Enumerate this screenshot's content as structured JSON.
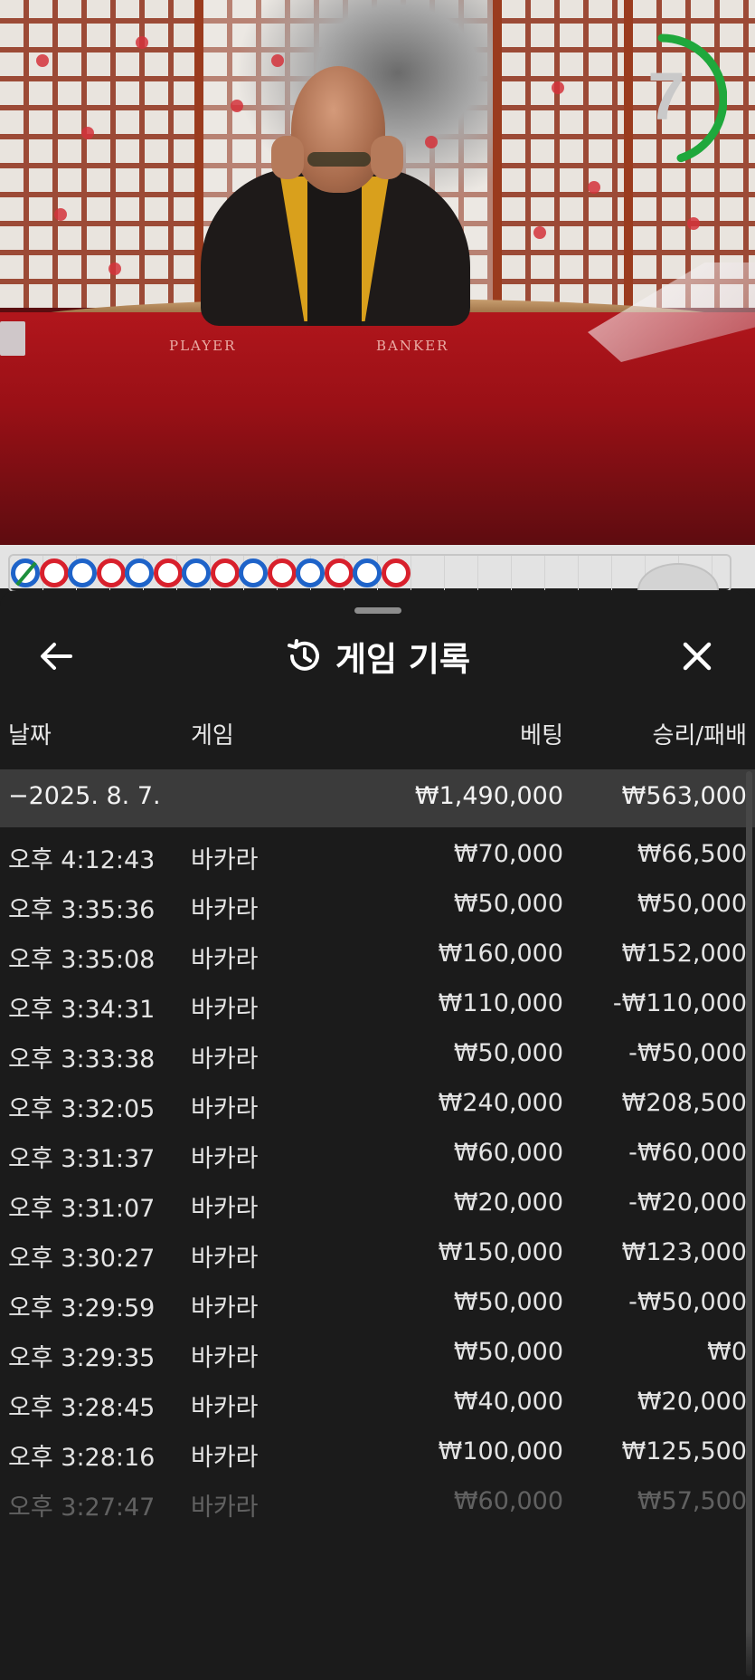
{
  "video": {
    "felt_labels": {
      "player": "PLAYER",
      "banker": "BANKER"
    },
    "timer": {
      "value": "7",
      "progress": 0.45,
      "color": "#1fa83c"
    }
  },
  "bead_road": {
    "beads": [
      "tie",
      "red",
      "blue",
      "red",
      "blue",
      "red",
      "blue",
      "red",
      "blue",
      "red",
      "blue",
      "red",
      "blue",
      "red"
    ],
    "colors": {
      "player": "#1e63c9",
      "banker": "#d8202c",
      "tie": "#1d8f3c"
    }
  },
  "history": {
    "title": "게임 기록",
    "icons": {
      "back": "arrow-left-icon",
      "history": "history-icon",
      "close": "close-icon"
    },
    "columns": {
      "date": "날짜",
      "game": "게임",
      "bet": "베팅",
      "result": "승리/패배"
    },
    "summary": {
      "date": "−2025. 8. 7.",
      "bet": "₩1,490,000",
      "result": "₩563,000"
    },
    "rows": [
      {
        "time": "오후 4:12:43",
        "game": "바카라",
        "bet": "₩70,000",
        "result": "₩66,500"
      },
      {
        "time": "오후 3:35:36",
        "game": "바카라",
        "bet": "₩50,000",
        "result": "₩50,000"
      },
      {
        "time": "오후 3:35:08",
        "game": "바카라",
        "bet": "₩160,000",
        "result": "₩152,000"
      },
      {
        "time": "오후 3:34:31",
        "game": "바카라",
        "bet": "₩110,000",
        "result": "-₩110,000"
      },
      {
        "time": "오후 3:33:38",
        "game": "바카라",
        "bet": "₩50,000",
        "result": "-₩50,000"
      },
      {
        "time": "오후 3:32:05",
        "game": "바카라",
        "bet": "₩240,000",
        "result": "₩208,500"
      },
      {
        "time": "오후 3:31:37",
        "game": "바카라",
        "bet": "₩60,000",
        "result": "-₩60,000"
      },
      {
        "time": "오후 3:31:07",
        "game": "바카라",
        "bet": "₩20,000",
        "result": "-₩20,000"
      },
      {
        "time": "오후 3:30:27",
        "game": "바카라",
        "bet": "₩150,000",
        "result": "₩123,000"
      },
      {
        "time": "오후 3:29:59",
        "game": "바카라",
        "bet": "₩50,000",
        "result": "-₩50,000"
      },
      {
        "time": "오후 3:29:35",
        "game": "바카라",
        "bet": "₩50,000",
        "result": "₩0"
      },
      {
        "time": "오후 3:28:45",
        "game": "바카라",
        "bet": "₩40,000",
        "result": "₩20,000"
      },
      {
        "time": "오후 3:28:16",
        "game": "바카라",
        "bet": "₩100,000",
        "result": "₩125,500"
      },
      {
        "time": "오후 3:27:47",
        "game": "바카라",
        "bet": "₩60,000",
        "result": "₩57,500"
      }
    ]
  }
}
